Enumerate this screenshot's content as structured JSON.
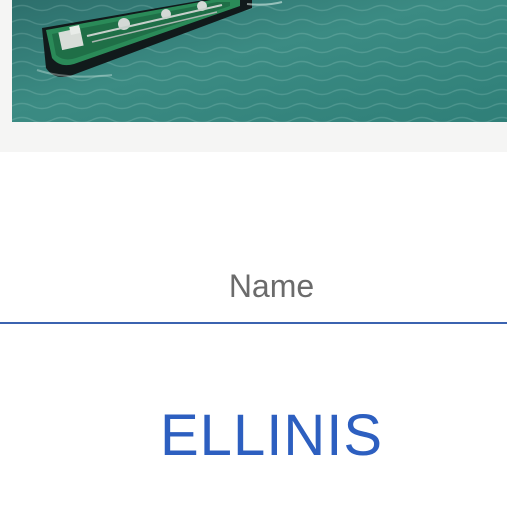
{
  "photo": {
    "icon": "ship-photo"
  },
  "field": {
    "label": "Name",
    "value": "ELLINIS"
  },
  "colors": {
    "label": "#6b6b6b",
    "accent": "#2d5fc0",
    "divider": "#3b63b0",
    "sea": "#2f7f78"
  }
}
